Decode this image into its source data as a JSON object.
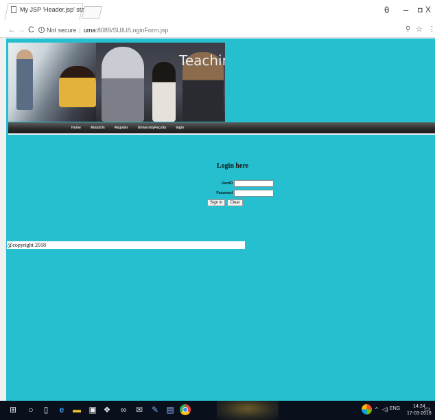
{
  "browser": {
    "tab_title": "My JSP 'Header.jsp' starti",
    "tab_close": "X",
    "profile_icon": "θ",
    "minimize": "–",
    "maximize": "◘",
    "close": "X",
    "omnibox": {
      "security_label": "Not secure",
      "separator": "|",
      "host": "uma",
      "rest": ":8089/SUIU/LoginForm.jsp"
    }
  },
  "page": {
    "banner_title": "Teaching",
    "nav": [
      "Home",
      "AboutUs",
      "Register",
      "UniversityFaculty",
      "login"
    ],
    "login": {
      "heading": "Login here",
      "user_label": "UserID",
      "password_label": "Password",
      "user_value": "",
      "password_value": "",
      "signin_label": "Sign in",
      "clear_label": "Clear"
    },
    "footer": "@copyright 2018"
  },
  "taskbar": {
    "lang": "ENG",
    "time": "14:24",
    "date": "17-03-2018"
  },
  "colors": {
    "page_background": "#26bfcf",
    "navbar": "#2a2a2a",
    "taskbar": "#0a0f1c"
  },
  "icons": [
    "page-icon",
    "back-arrow-icon",
    "forward-arrow-icon",
    "reload-icon",
    "info-icon",
    "zoom-icon",
    "star-icon",
    "menu-icon",
    "windows-start-icon",
    "search-icon",
    "task-view-icon",
    "edge-icon",
    "file-explorer-icon",
    "store-icon",
    "dropbox-icon",
    "infinity-icon",
    "mail-icon",
    "pen-icon",
    "word-icon",
    "chrome-icon",
    "color-wheel-icon",
    "sound-icon",
    "notification-icon"
  ]
}
